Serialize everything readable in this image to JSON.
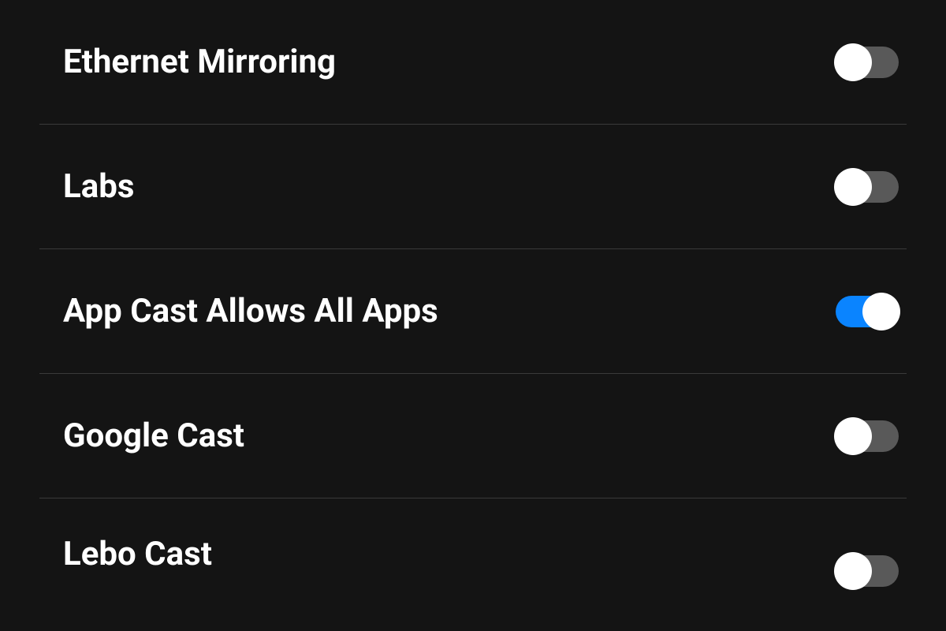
{
  "settings": [
    {
      "label": "Ethernet Mirroring",
      "state": "off",
      "name": "ethernet-mirroring"
    },
    {
      "label": "Labs",
      "state": "off",
      "name": "labs"
    },
    {
      "label": "App Cast Allows All Apps",
      "state": "on",
      "name": "app-cast-allows-all-apps"
    },
    {
      "label": "Google Cast",
      "state": "off",
      "name": "google-cast"
    },
    {
      "label": "Lebo Cast",
      "state": "off",
      "name": "lebo-cast"
    }
  ]
}
